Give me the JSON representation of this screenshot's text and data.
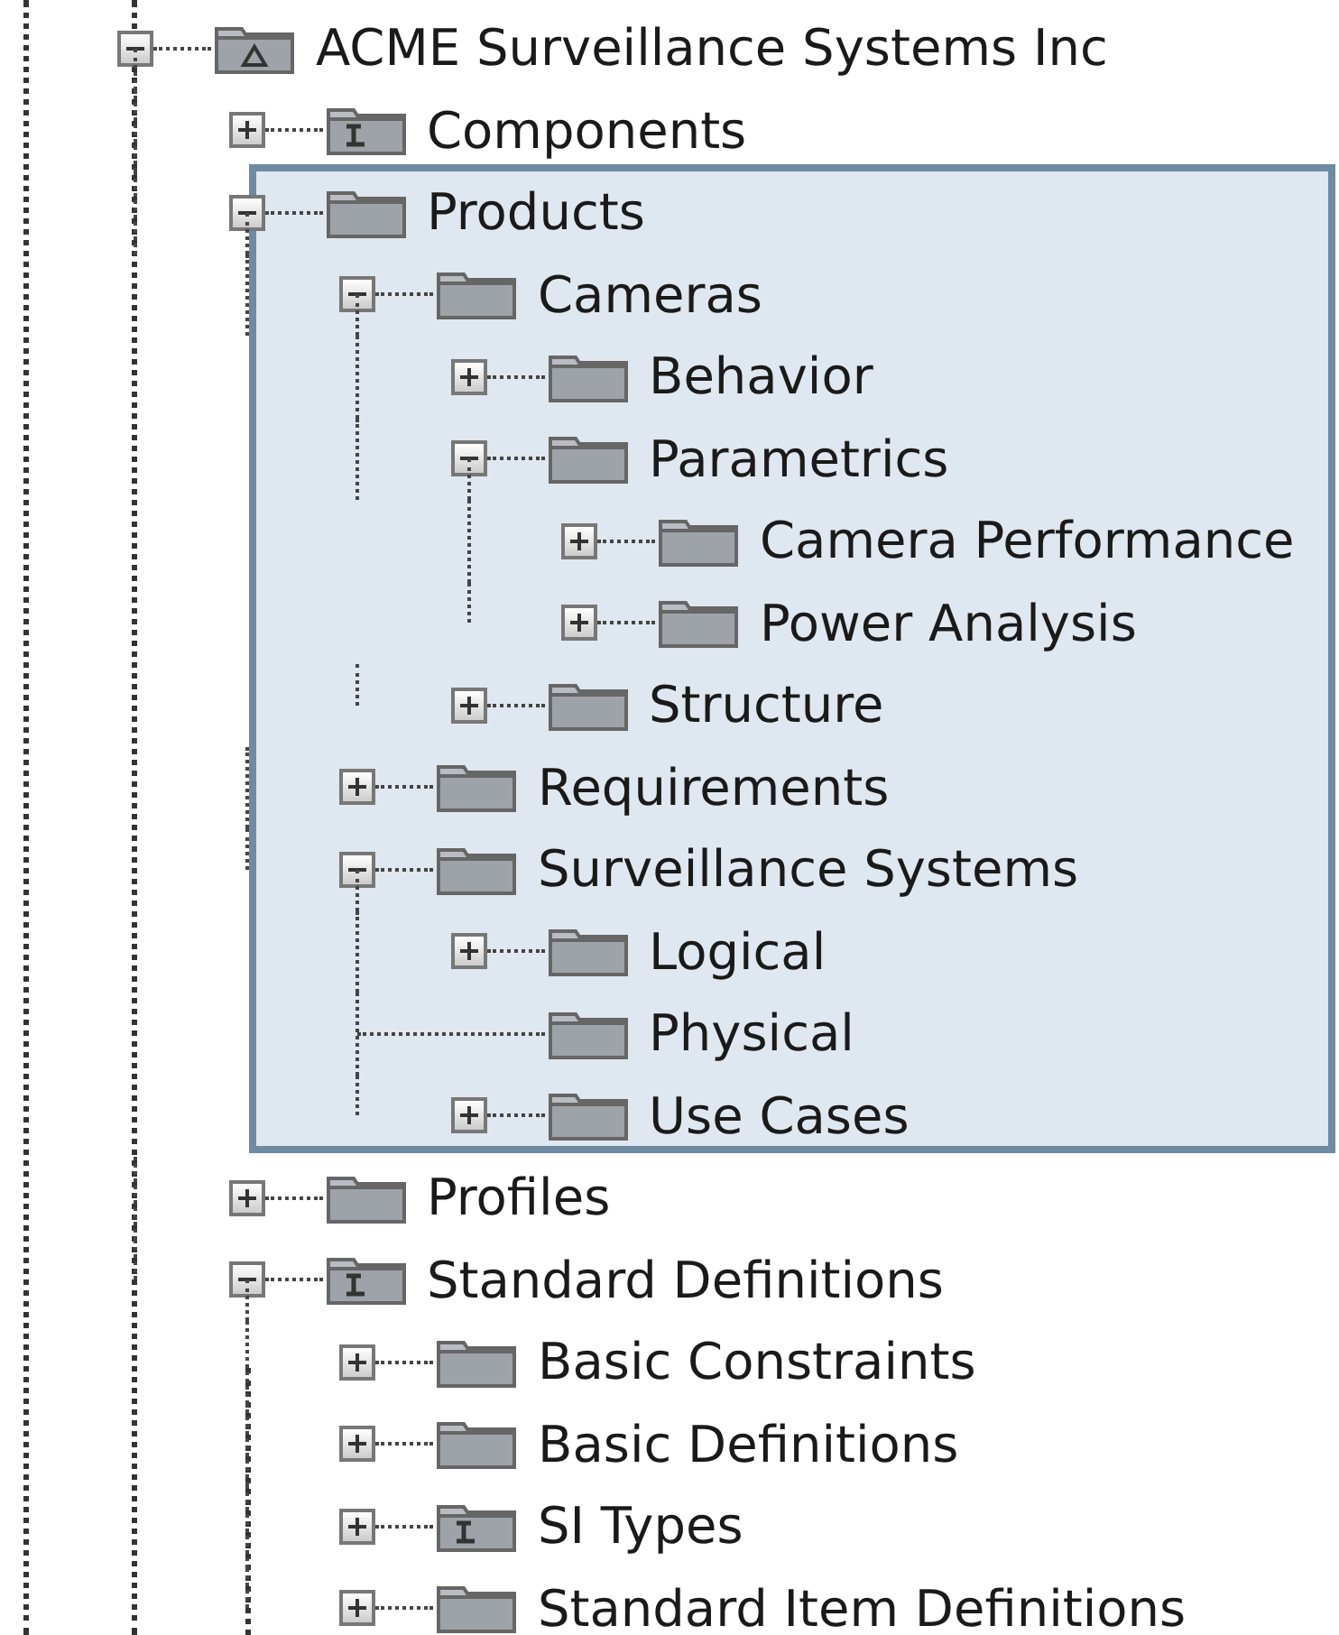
{
  "tree": [
    {
      "label": "ACME Surveillance Systems Inc",
      "kind": "model",
      "expanded": true,
      "children": [
        {
          "label": "Components",
          "kind": "library",
          "expanded": false
        },
        {
          "label": "Products",
          "kind": "folder",
          "expanded": true,
          "highlighted": true,
          "children": [
            {
              "label": "Cameras",
              "kind": "folder",
              "expanded": true,
              "children": [
                {
                  "label": "Behavior",
                  "kind": "folder",
                  "expanded": false
                },
                {
                  "label": "Parametrics",
                  "kind": "folder",
                  "expanded": true,
                  "children": [
                    {
                      "label": "Camera Performance",
                      "kind": "folder",
                      "expanded": false
                    },
                    {
                      "label": "Power Analysis",
                      "kind": "folder",
                      "expanded": false
                    }
                  ]
                },
                {
                  "label": "Structure",
                  "kind": "folder",
                  "expanded": false
                }
              ]
            },
            {
              "label": "Requirements",
              "kind": "folder",
              "expanded": false
            },
            {
              "label": "Surveillance Systems",
              "kind": "folder",
              "expanded": true,
              "children": [
                {
                  "label": "Logical",
                  "kind": "folder",
                  "expanded": false
                },
                {
                  "label": "Physical",
                  "kind": "folder"
                },
                {
                  "label": "Use Cases",
                  "kind": "folder",
                  "expanded": false
                }
              ]
            }
          ]
        },
        {
          "label": "Profiles",
          "kind": "folder",
          "expanded": false
        },
        {
          "label": "Standard Definitions",
          "kind": "library",
          "expanded": true,
          "children": [
            {
              "label": "Basic Constraints",
              "kind": "folder",
              "expanded": false
            },
            {
              "label": "Basic Definitions",
              "kind": "folder",
              "expanded": false
            },
            {
              "label": "SI Types",
              "kind": "library",
              "expanded": false
            },
            {
              "label": "Standard Item Definitions",
              "kind": "folder",
              "expanded": false
            }
          ]
        }
      ]
    }
  ]
}
